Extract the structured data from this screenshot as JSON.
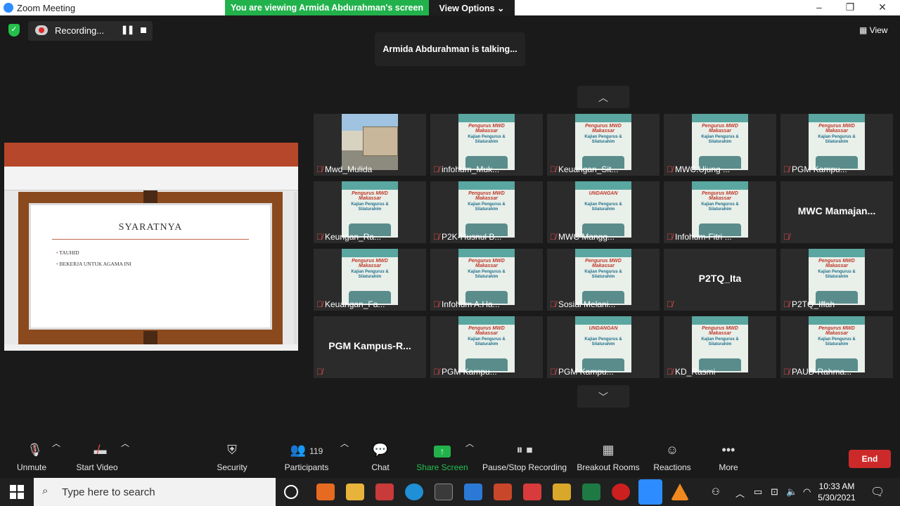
{
  "window": {
    "title": "Zoom Meeting",
    "min": "–",
    "max": "❐",
    "close": "✕"
  },
  "banner": {
    "viewing": "You are viewing Armida Abdurahman's screen",
    "options": "View Options ⌄"
  },
  "recording": {
    "label": "Recording...",
    "pause": "❚❚"
  },
  "talking": "Armida Abdurahman is talking...",
  "view_button": "View",
  "shared": {
    "slide_title": "SYARATNYA",
    "bullets": [
      "TAUHID",
      "BEKERJA UNTUK AGAMA INI"
    ]
  },
  "pager": {
    "up": "︿",
    "down": "﹀"
  },
  "poster": {
    "a": "Pengurus MWD Makassar",
    "b": "Kajian Pengurus & Silaturahim",
    "c": "UNDANGAN"
  },
  "tiles": [
    {
      "name": "Mwd_Mulida",
      "kind": "photo"
    },
    {
      "name": "infohum_Muk...",
      "kind": "poster"
    },
    {
      "name": "Keuangan_Sit...",
      "kind": "poster"
    },
    {
      "name": "MWC.Ujung ...",
      "kind": "poster"
    },
    {
      "name": "PGM Kampu...",
      "kind": "poster"
    },
    {
      "name": "Keungan_Ra...",
      "kind": "poster"
    },
    {
      "name": "P2K-Husnul B...",
      "kind": "poster"
    },
    {
      "name": "MWC Mangg...",
      "kind": "poster"
    },
    {
      "name": "Infohum-Fitri ...",
      "kind": "poster"
    },
    {
      "name": "MWC  Mamajan...",
      "kind": "text"
    },
    {
      "name": "Keuangan_Fa...",
      "kind": "poster"
    },
    {
      "name": "Infohum A.Ha...",
      "kind": "poster"
    },
    {
      "name": "Sosial Melani...",
      "kind": "poster"
    },
    {
      "name": "P2TQ_Ita",
      "kind": "text"
    },
    {
      "name": "P2TQ_Iffah",
      "kind": "poster"
    },
    {
      "name": "PGM  Kampus-R...",
      "kind": "text"
    },
    {
      "name": "PGM Kampu...",
      "kind": "poster"
    },
    {
      "name": "PGM Kampu...",
      "kind": "poster"
    },
    {
      "name": "KD_Rasmi",
      "kind": "poster"
    },
    {
      "name": "PAUD-Rahma...",
      "kind": "poster"
    }
  ],
  "toolbar": {
    "unmute": "Unmute",
    "start_video": "Start Video",
    "security": "Security",
    "participants": "Participants",
    "participants_count": "119",
    "chat": "Chat",
    "share_screen": "Share Screen",
    "pause_recording": "Pause/Stop Recording",
    "breakout": "Breakout Rooms",
    "reactions": "Reactions",
    "more": "More",
    "end": "End"
  },
  "taskbar": {
    "search_placeholder": "Type here to search",
    "time": "10:33 AM",
    "date": "5/30/2021"
  }
}
